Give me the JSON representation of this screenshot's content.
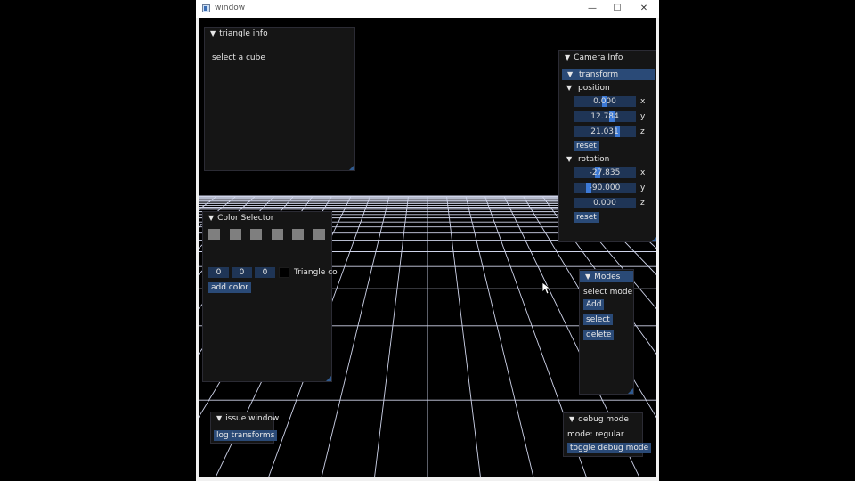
{
  "window": {
    "title": "window",
    "minimize_glyph": "—",
    "maximize_glyph": "☐",
    "close_glyph": "✕"
  },
  "triangle_info": {
    "title": "triangle info",
    "message": "select a cube"
  },
  "camera_info": {
    "title": "Camera Info",
    "transform_label": "transform",
    "position": {
      "label": "position",
      "x": "0.000",
      "y": "12.784",
      "z": "21.031",
      "reset": "reset"
    },
    "rotation": {
      "label": "rotation",
      "x": "-27.835",
      "y": "-90.000",
      "z": "0.000",
      "reset": "reset"
    },
    "axis": {
      "x": "x",
      "y": "y",
      "z": "z"
    }
  },
  "color_selector": {
    "title": "Color Selector",
    "swatch_count": 6,
    "swatch_color": "#7f7f7f",
    "rgb": [
      "0",
      "0",
      "0"
    ],
    "triangle_label": "Triangle co",
    "add_color": "add color"
  },
  "modes": {
    "title": "Modes",
    "status": "select mode",
    "buttons": [
      "Add",
      "select",
      "delete"
    ]
  },
  "issue_window": {
    "title": "issue window",
    "button": "log transforms"
  },
  "debug_mode": {
    "title": "debug mode",
    "status": "mode: regular",
    "button": "toggle debug mode"
  },
  "colors": {
    "accent": "#2a4a77",
    "field": "#1f3556",
    "grab": "#3d7ad6",
    "grid": "#cfd4ea"
  }
}
